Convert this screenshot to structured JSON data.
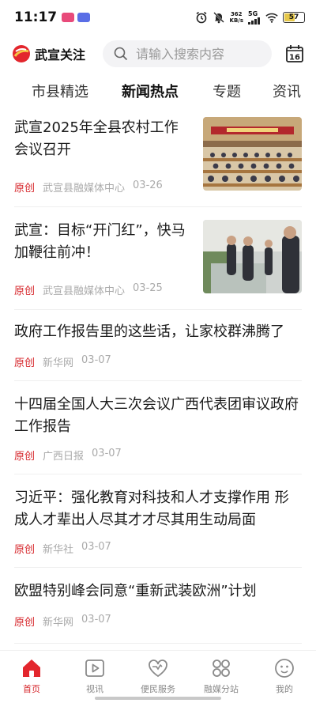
{
  "status_bar": {
    "time": "11:17",
    "net_speed_value": "362",
    "net_speed_unit": "KB/s",
    "signal_label": "5G",
    "battery": "57",
    "battery_level": 0.57
  },
  "header": {
    "app_name": "武宣关注",
    "search_placeholder": "请输入搜索内容",
    "calendar_day": "16"
  },
  "tabs": [
    {
      "label": "市县精选",
      "active": false
    },
    {
      "label": "新闻热点",
      "active": true
    },
    {
      "label": "专题",
      "active": false
    },
    {
      "label": "资讯",
      "active": false
    }
  ],
  "news": [
    {
      "title": "武宣2025年全县农村工作会议召开",
      "tag": "原创",
      "source": "武宣县融媒体中心",
      "date": "03-26",
      "image": "meeting-photo"
    },
    {
      "title": "武宣：目标“开门红”，快马加鞭往前冲！",
      "tag": "原创",
      "source": "武宣县融媒体中心",
      "date": "03-25",
      "image": "inspection-photo"
    },
    {
      "title": "政府工作报告里的这些话，让家校群沸腾了",
      "tag": "原创",
      "source": "新华网",
      "date": "03-07"
    },
    {
      "title": "十四届全国人大三次会议广西代表团审议政府工作报告",
      "tag": "原创",
      "source": "广西日报",
      "date": "03-07"
    },
    {
      "title": "习近平：强化教育对科技和人才支撑作用 形成人才辈出人尽其才才尽其用生动局面",
      "tag": "原创",
      "source": "新华社",
      "date": "03-07"
    },
    {
      "title": "欧盟特别峰会同意“重新武装欧洲”计划",
      "tag": "原创",
      "source": "新华网",
      "date": "03-07"
    }
  ],
  "bottom_nav": [
    {
      "label": "首页",
      "icon": "home-icon",
      "active": true
    },
    {
      "label": "视讯",
      "icon": "video-icon",
      "active": false
    },
    {
      "label": "便民服务",
      "icon": "heart-service-icon",
      "active": false
    },
    {
      "label": "融媒分站",
      "icon": "grid-station-icon",
      "active": false
    },
    {
      "label": "我的",
      "icon": "profile-icon",
      "active": false
    }
  ],
  "colors": {
    "accent": "#d6262b",
    "muted_text": "#aaaaaa",
    "search_bg": "#f3f3f5"
  }
}
